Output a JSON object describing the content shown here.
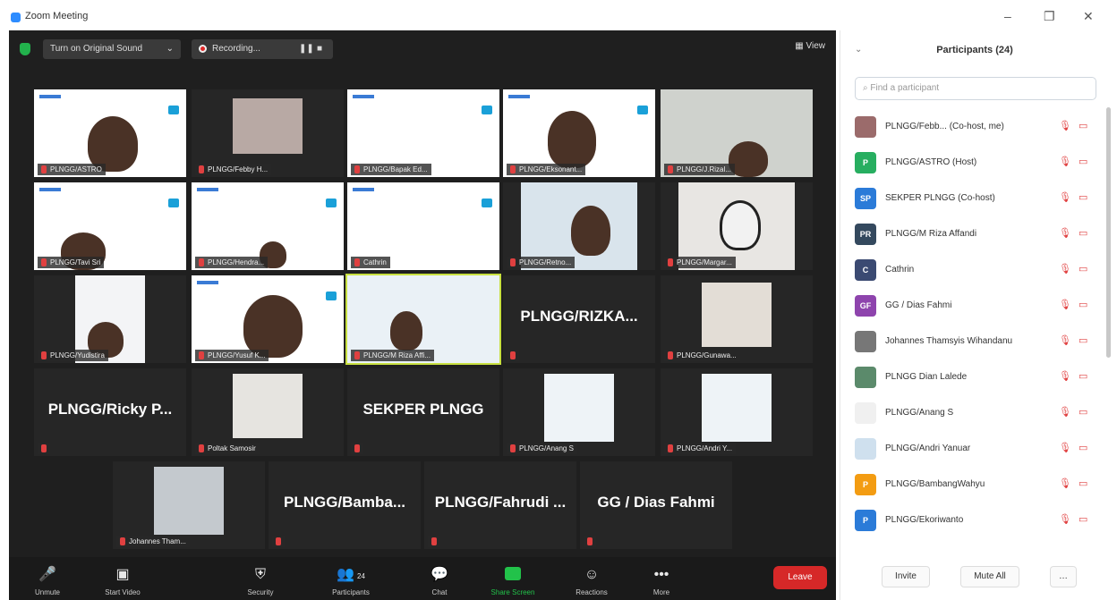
{
  "window": {
    "title": "Zoom Meeting"
  },
  "topbar": {
    "original_sound": "Turn on Original Sound",
    "recording": "Recording...",
    "view": "View"
  },
  "tiles": {
    "r1": [
      "PLNGG/ASTRO",
      "PLNGG/Febby H...",
      "PLNGG/Bapak Ed...",
      "PLNGG/Eksonant...",
      "PLNGG/J.Rizal..."
    ],
    "r2": [
      "PLNGG/Tavi Sri",
      "PLNGG/Hendra...",
      "Cathrin",
      "PLNGG/Retno...",
      "PLNGG/Margar..."
    ],
    "r3": [
      "PLNGG/Yudistira",
      "PLNGG/Yusuf K...",
      "PLNGG/M Riza Affi...",
      "PLNGG/RIZKA...",
      "PLNGG/Gunawa..."
    ],
    "r4": [
      "PLNGG/Ricky  P...",
      "Poltak Samosir",
      "SEKPER PLNGG",
      "PLNGG/Anang S",
      "PLNGG/Andri Y..."
    ],
    "r5": [
      "Johannes Tham...",
      "PLNGG/Bamba...",
      "PLNGG/Fahrudi ...",
      "GG / Dias Fahmi"
    ]
  },
  "toolbar": {
    "unmute": "Unmute",
    "video": "Start Video",
    "security": "Security",
    "participants": "Participants",
    "participants_count": "24",
    "chat": "Chat",
    "share": "Share Screen",
    "reactions": "Reactions",
    "more": "More",
    "leave": "Leave"
  },
  "panel": {
    "title": "Participants (24)",
    "search_placeholder": "Find a participant",
    "participants": [
      {
        "initials": "",
        "name": "PLNGG/Febb... (Co-host, me)",
        "color": "#9b6b6b"
      },
      {
        "initials": "P",
        "name": "PLNGG/ASTRO (Host)",
        "color": "#27ae60"
      },
      {
        "initials": "SP",
        "name": "SEKPER PLNGG (Co-host)",
        "color": "#2b7bd8"
      },
      {
        "initials": "PR",
        "name": "PLNGG/M Riza Affandi",
        "color": "#34495e"
      },
      {
        "initials": "C",
        "name": "Cathrin",
        "color": "#3b4a72"
      },
      {
        "initials": "GF",
        "name": "GG / Dias Fahmi",
        "color": "#8e44ad"
      },
      {
        "initials": "",
        "name": "Johannes Thamsyis Wihandanu",
        "color": "#777777"
      },
      {
        "initials": "",
        "name": "PLNGG Dian Lalede",
        "color": "#5b8a6b"
      },
      {
        "initials": "",
        "name": "PLNGG/Anang S",
        "color": "#f0f0f0"
      },
      {
        "initials": "",
        "name": "PLNGG/Andri Yanuar",
        "color": "#cfe0ee"
      },
      {
        "initials": "P",
        "name": "PLNGG/BambangWahyu",
        "color": "#f39c12"
      },
      {
        "initials": "P",
        "name": "PLNGG/Ekoriwanto",
        "color": "#2b7bd8"
      }
    ],
    "invite": "Invite",
    "mute_all": "Mute All"
  },
  "colors": {
    "accent": "#2d8cff",
    "leave": "#d62828",
    "muted": "#e04040",
    "share": "#22c24a"
  }
}
